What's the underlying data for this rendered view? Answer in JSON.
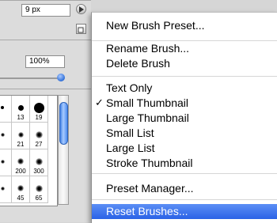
{
  "panel": {
    "size_value": "9 px",
    "percent_value": "100%",
    "brush_presets": [
      {
        "num": "",
        "d": 4
      },
      {
        "num": "13",
        "d": 7
      },
      {
        "num": "19",
        "d": 13
      },
      {
        "num": "",
        "d": 5
      },
      {
        "num": "21",
        "d": 7
      },
      {
        "num": "27",
        "d": 9
      },
      {
        "num": "",
        "d": 5
      },
      {
        "num": "200",
        "d": 8
      },
      {
        "num": "300",
        "d": 9
      },
      {
        "num": "",
        "d": 5
      },
      {
        "num": "45",
        "d": 8
      },
      {
        "num": "65",
        "d": 9
      }
    ]
  },
  "menu": {
    "items": [
      {
        "label": "New Brush Preset..."
      },
      {
        "label": "Rename Brush..."
      },
      {
        "label": "Delete Brush"
      },
      {
        "label": "Text Only"
      },
      {
        "label": "Small Thumbnail",
        "checked": true
      },
      {
        "label": "Large Thumbnail"
      },
      {
        "label": "Small List"
      },
      {
        "label": "Large List"
      },
      {
        "label": "Stroke Thumbnail"
      },
      {
        "label": "Preset Manager..."
      },
      {
        "label": "Reset Brushes...",
        "highlighted": true
      }
    ],
    "check_mark": "✓"
  },
  "colors": {
    "menu_highlight": "#2a62e6",
    "scroll_thumb": "#4d8cf0"
  }
}
